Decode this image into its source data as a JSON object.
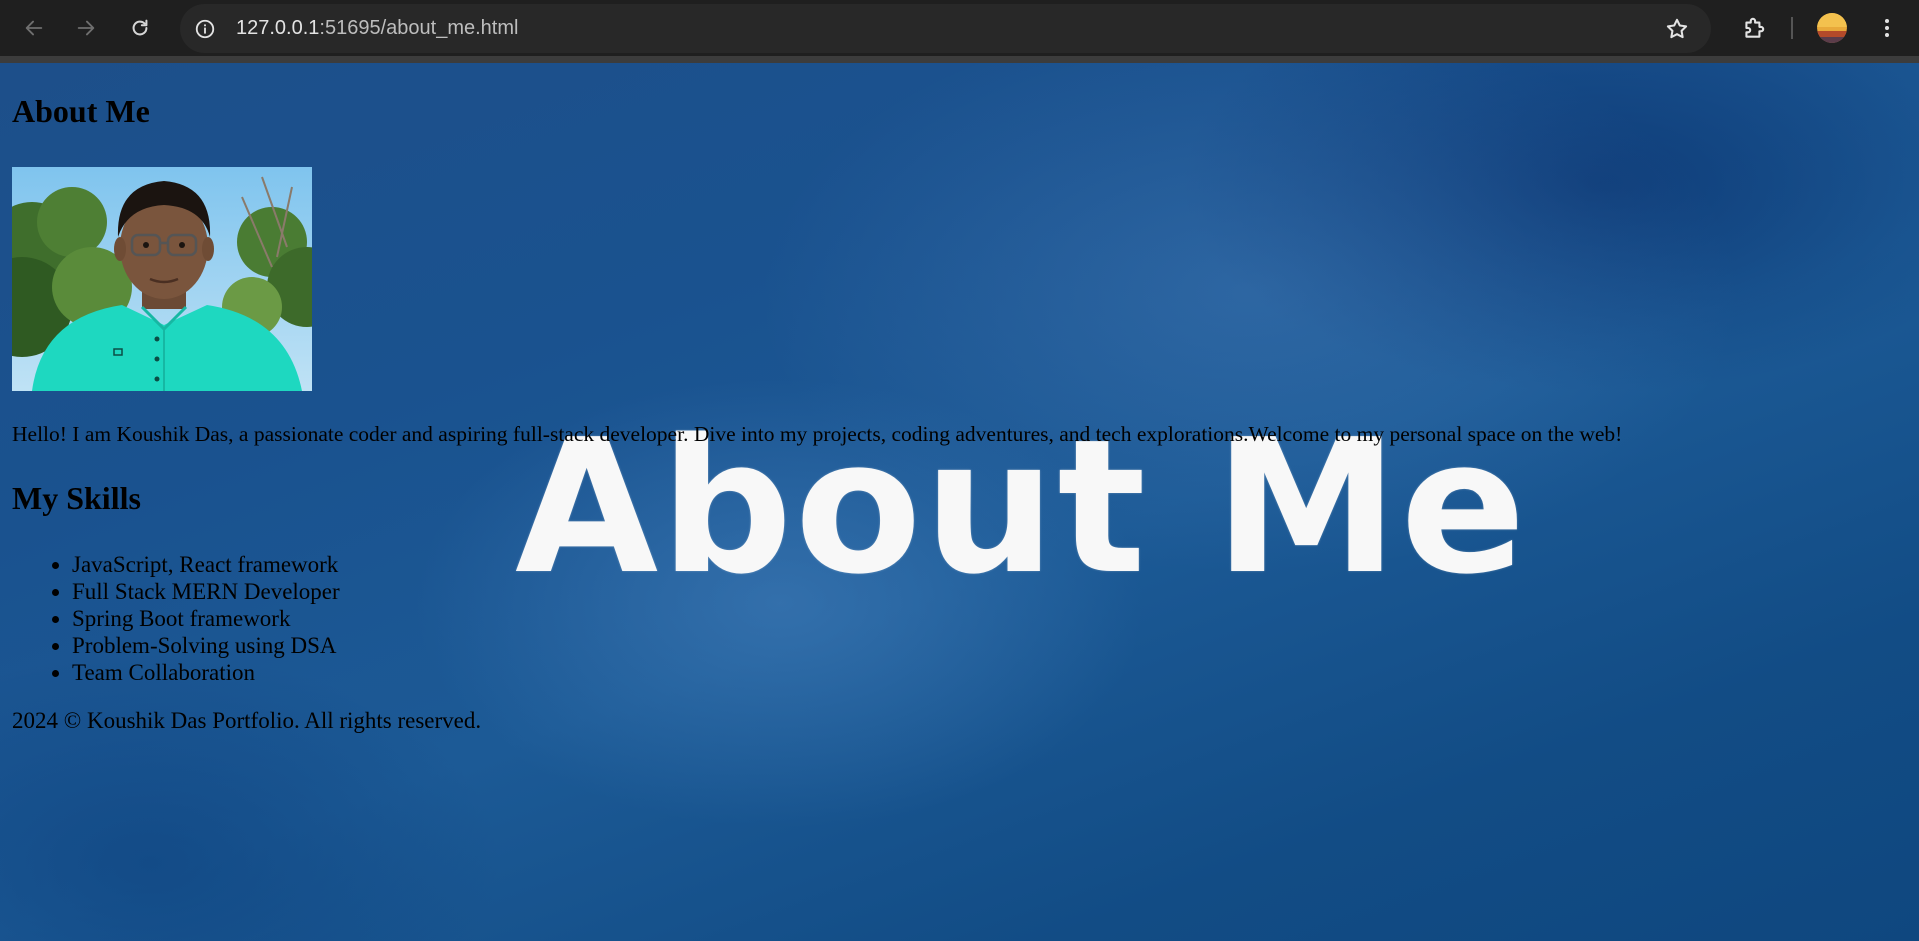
{
  "browser": {
    "url_host": "127.0.0.1",
    "url_path": ":51695/about_me.html"
  },
  "page": {
    "title": "About Me",
    "intro": "Hello! I am Koushik Das, a passionate coder and aspiring full-stack developer. Dive into my projects, coding adventures, and tech explorations.Welcome to my personal space on the web!",
    "skills_title": "My Skills",
    "skills": [
      "JavaScript, React framework",
      "Full Stack MERN Developer",
      "Spring Boot framework",
      "Problem-Solving using DSA",
      "Team Collaboration"
    ],
    "footer": "2024 © Koushik Das Portfolio. All rights reserved.",
    "background_word": "About Me"
  },
  "colors": {
    "chrome_bg": "#1f1f1f",
    "omnibox_bg": "#282828",
    "page_bg": "#1c5590",
    "accent_shirt": "#1ed8c0"
  }
}
